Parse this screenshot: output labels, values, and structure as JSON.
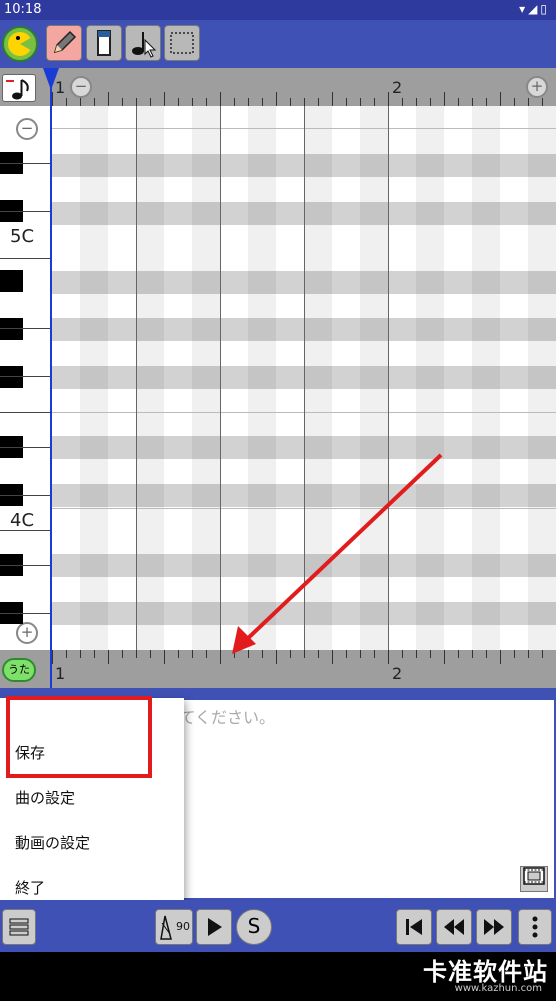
{
  "status": {
    "time": "10:18",
    "icons": "▾◢▯"
  },
  "ruler": {
    "measure1": "1",
    "measure2": "2"
  },
  "piano": {
    "label_5c": "5C",
    "label_4c": "4C"
  },
  "lyrics": {
    "placeholder": "歌詞をひらがなで入力してください。"
  },
  "menu": {
    "items": [
      "保存",
      "曲の設定",
      "動画の設定",
      "終了"
    ]
  },
  "uta_badge": "うた",
  "tempo": "90",
  "solo_label": "S",
  "watermark": {
    "text": "卡准软件站",
    "url": "www.kazhun.com"
  },
  "colors": {
    "primary": "#3f51b5",
    "accent_red": "#e21c1c",
    "cursor": "#1a3bd6"
  }
}
